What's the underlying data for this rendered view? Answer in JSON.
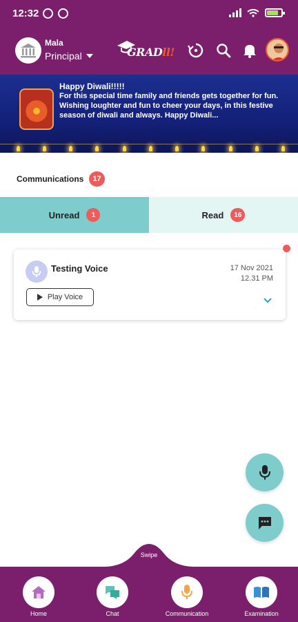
{
  "status_bar": {
    "time": "12:32"
  },
  "header": {
    "user_name": "Mala",
    "role": "Principal",
    "logo_text": "GRAD",
    "logo_suffix": "ll!"
  },
  "banner": {
    "title": "Happy Diwali!!!!!",
    "text": "For this special time family and friends gets together for fun. Wishing loughter and fun to cheer your days, in this festive season of diwali and always. Happy Diwali..."
  },
  "communications": {
    "label": "Communications",
    "count": "17"
  },
  "tabs": [
    {
      "label": "Unread",
      "count": "1"
    },
    {
      "label": "Read",
      "count": "16"
    }
  ],
  "card": {
    "title": "Testing Voice",
    "date": "17 Nov 2021",
    "time": "12.31 PM",
    "play_label": "Play Voice"
  },
  "swipe_label": "Swipe",
  "nav": [
    {
      "label": "Home",
      "icon": "home-icon"
    },
    {
      "label": "Chat",
      "icon": "chat-icon"
    },
    {
      "label": "Communication",
      "icon": "microphone-icon"
    },
    {
      "label": "Examination",
      "icon": "book-icon"
    }
  ],
  "colors": {
    "primary": "#7b1e6b",
    "teal": "#7fcccc",
    "badge": "#ef5a5a"
  }
}
